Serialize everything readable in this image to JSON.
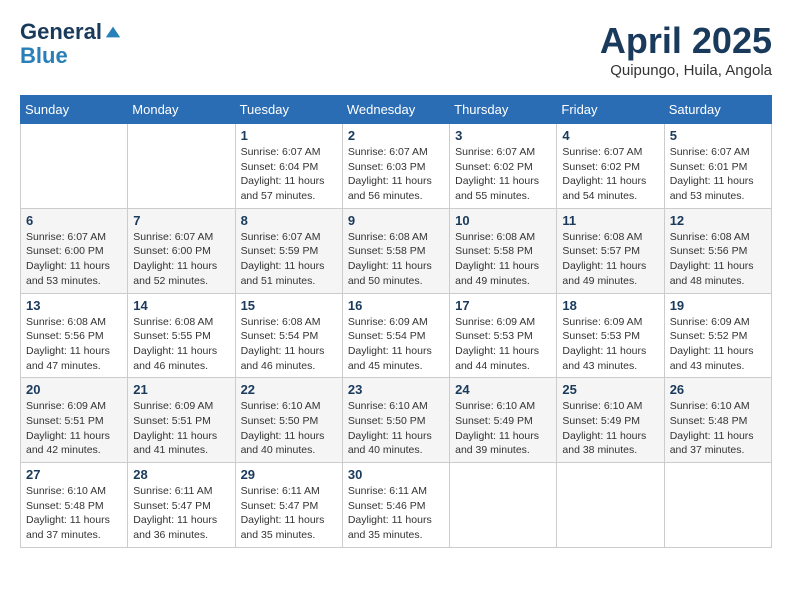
{
  "header": {
    "logo_line1": "General",
    "logo_line2": "Blue",
    "month": "April 2025",
    "location": "Quipungo, Huila, Angola"
  },
  "weekdays": [
    "Sunday",
    "Monday",
    "Tuesday",
    "Wednesday",
    "Thursday",
    "Friday",
    "Saturday"
  ],
  "weeks": [
    [
      {
        "day": "",
        "info": ""
      },
      {
        "day": "",
        "info": ""
      },
      {
        "day": "1",
        "info": "Sunrise: 6:07 AM\nSunset: 6:04 PM\nDaylight: 11 hours and 57 minutes."
      },
      {
        "day": "2",
        "info": "Sunrise: 6:07 AM\nSunset: 6:03 PM\nDaylight: 11 hours and 56 minutes."
      },
      {
        "day": "3",
        "info": "Sunrise: 6:07 AM\nSunset: 6:02 PM\nDaylight: 11 hours and 55 minutes."
      },
      {
        "day": "4",
        "info": "Sunrise: 6:07 AM\nSunset: 6:02 PM\nDaylight: 11 hours and 54 minutes."
      },
      {
        "day": "5",
        "info": "Sunrise: 6:07 AM\nSunset: 6:01 PM\nDaylight: 11 hours and 53 minutes."
      }
    ],
    [
      {
        "day": "6",
        "info": "Sunrise: 6:07 AM\nSunset: 6:00 PM\nDaylight: 11 hours and 53 minutes."
      },
      {
        "day": "7",
        "info": "Sunrise: 6:07 AM\nSunset: 6:00 PM\nDaylight: 11 hours and 52 minutes."
      },
      {
        "day": "8",
        "info": "Sunrise: 6:07 AM\nSunset: 5:59 PM\nDaylight: 11 hours and 51 minutes."
      },
      {
        "day": "9",
        "info": "Sunrise: 6:08 AM\nSunset: 5:58 PM\nDaylight: 11 hours and 50 minutes."
      },
      {
        "day": "10",
        "info": "Sunrise: 6:08 AM\nSunset: 5:58 PM\nDaylight: 11 hours and 49 minutes."
      },
      {
        "day": "11",
        "info": "Sunrise: 6:08 AM\nSunset: 5:57 PM\nDaylight: 11 hours and 49 minutes."
      },
      {
        "day": "12",
        "info": "Sunrise: 6:08 AM\nSunset: 5:56 PM\nDaylight: 11 hours and 48 minutes."
      }
    ],
    [
      {
        "day": "13",
        "info": "Sunrise: 6:08 AM\nSunset: 5:56 PM\nDaylight: 11 hours and 47 minutes."
      },
      {
        "day": "14",
        "info": "Sunrise: 6:08 AM\nSunset: 5:55 PM\nDaylight: 11 hours and 46 minutes."
      },
      {
        "day": "15",
        "info": "Sunrise: 6:08 AM\nSunset: 5:54 PM\nDaylight: 11 hours and 46 minutes."
      },
      {
        "day": "16",
        "info": "Sunrise: 6:09 AM\nSunset: 5:54 PM\nDaylight: 11 hours and 45 minutes."
      },
      {
        "day": "17",
        "info": "Sunrise: 6:09 AM\nSunset: 5:53 PM\nDaylight: 11 hours and 44 minutes."
      },
      {
        "day": "18",
        "info": "Sunrise: 6:09 AM\nSunset: 5:53 PM\nDaylight: 11 hours and 43 minutes."
      },
      {
        "day": "19",
        "info": "Sunrise: 6:09 AM\nSunset: 5:52 PM\nDaylight: 11 hours and 43 minutes."
      }
    ],
    [
      {
        "day": "20",
        "info": "Sunrise: 6:09 AM\nSunset: 5:51 PM\nDaylight: 11 hours and 42 minutes."
      },
      {
        "day": "21",
        "info": "Sunrise: 6:09 AM\nSunset: 5:51 PM\nDaylight: 11 hours and 41 minutes."
      },
      {
        "day": "22",
        "info": "Sunrise: 6:10 AM\nSunset: 5:50 PM\nDaylight: 11 hours and 40 minutes."
      },
      {
        "day": "23",
        "info": "Sunrise: 6:10 AM\nSunset: 5:50 PM\nDaylight: 11 hours and 40 minutes."
      },
      {
        "day": "24",
        "info": "Sunrise: 6:10 AM\nSunset: 5:49 PM\nDaylight: 11 hours and 39 minutes."
      },
      {
        "day": "25",
        "info": "Sunrise: 6:10 AM\nSunset: 5:49 PM\nDaylight: 11 hours and 38 minutes."
      },
      {
        "day": "26",
        "info": "Sunrise: 6:10 AM\nSunset: 5:48 PM\nDaylight: 11 hours and 37 minutes."
      }
    ],
    [
      {
        "day": "27",
        "info": "Sunrise: 6:10 AM\nSunset: 5:48 PM\nDaylight: 11 hours and 37 minutes."
      },
      {
        "day": "28",
        "info": "Sunrise: 6:11 AM\nSunset: 5:47 PM\nDaylight: 11 hours and 36 minutes."
      },
      {
        "day": "29",
        "info": "Sunrise: 6:11 AM\nSunset: 5:47 PM\nDaylight: 11 hours and 35 minutes."
      },
      {
        "day": "30",
        "info": "Sunrise: 6:11 AM\nSunset: 5:46 PM\nDaylight: 11 hours and 35 minutes."
      },
      {
        "day": "",
        "info": ""
      },
      {
        "day": "",
        "info": ""
      },
      {
        "day": "",
        "info": ""
      }
    ]
  ]
}
